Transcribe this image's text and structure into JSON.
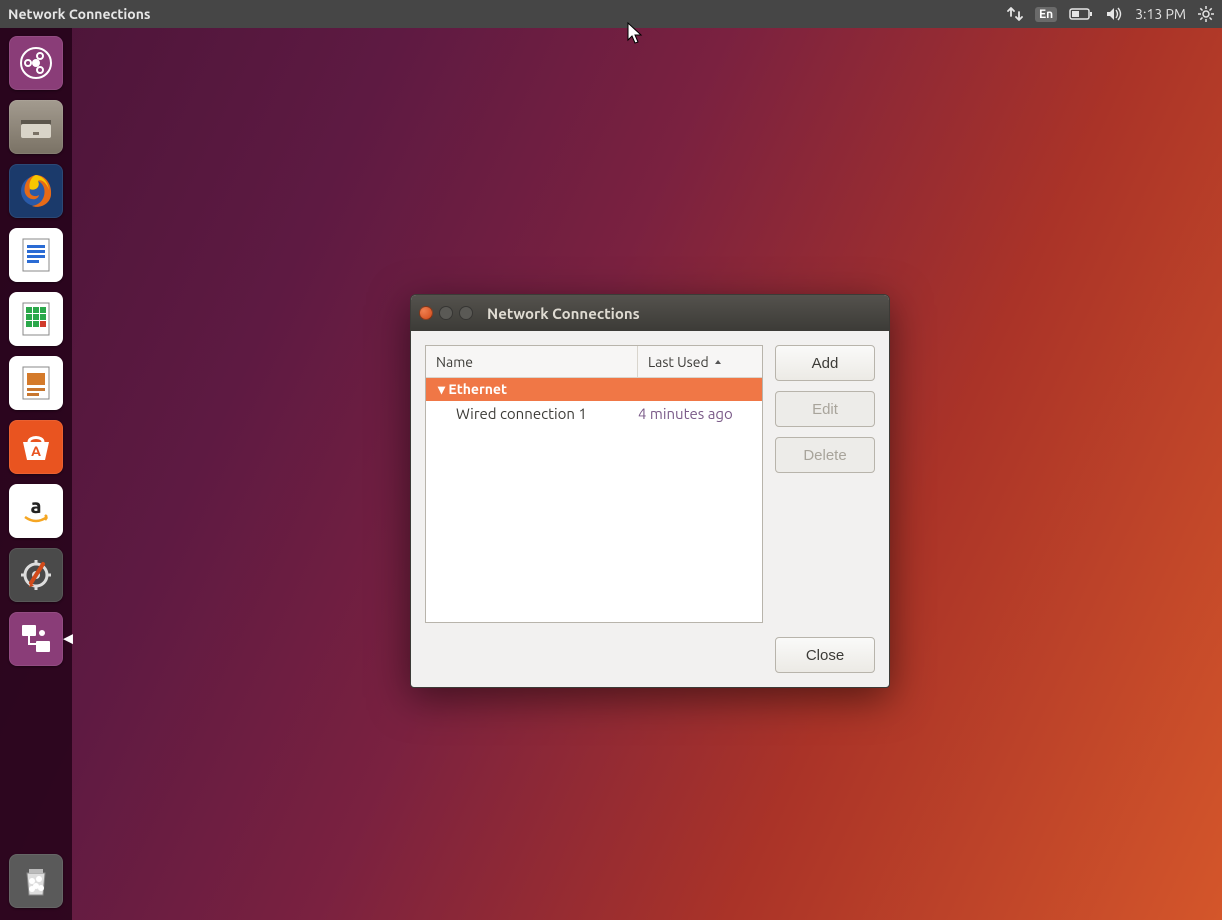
{
  "menubar": {
    "title": "Network Connections",
    "language": "En",
    "clock": "3:13 PM"
  },
  "launcher": {
    "items": [
      {
        "name": "dash",
        "bg": "#8a3d78"
      },
      {
        "name": "files",
        "bg": "#d9d5cd"
      },
      {
        "name": "firefox",
        "bg": "#1b3a6b"
      },
      {
        "name": "writer",
        "bg": "#ffffff"
      },
      {
        "name": "calc",
        "bg": "#ffffff"
      },
      {
        "name": "impress",
        "bg": "#ffffff"
      },
      {
        "name": "software",
        "bg": "#e95420"
      },
      {
        "name": "amazon",
        "bg": "#ffffff"
      },
      {
        "name": "settings",
        "bg": "#4a4a4a"
      },
      {
        "name": "network-connections",
        "bg": "#8a3d78"
      }
    ],
    "trash": {
      "name": "trash"
    }
  },
  "dialog": {
    "title": "Network Connections",
    "columns": {
      "name": "Name",
      "last_used": "Last Used"
    },
    "category": "Ethernet",
    "rows": [
      {
        "name": "Wired connection 1",
        "last": "4 minutes ago"
      }
    ],
    "buttons": {
      "add": "Add",
      "edit": "Edit",
      "delete": "Delete",
      "close": "Close"
    }
  }
}
